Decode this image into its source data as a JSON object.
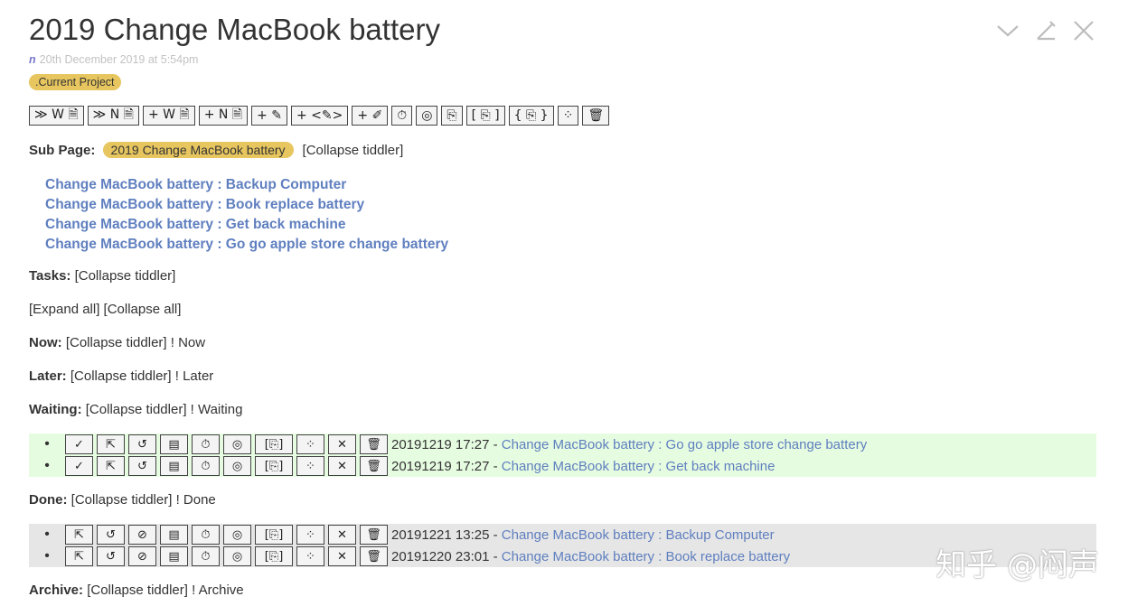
{
  "tiddler": {
    "title": "2019 Change MacBook battery",
    "modifier": "n",
    "modified": "20th December 2019 at 5:54pm",
    "tag": ".Current Project"
  },
  "toolbar": [
    {
      "label": "≫ W 🗎",
      "icon": "new-journal-w-icon"
    },
    {
      "label": "≫ N 🗎",
      "icon": "new-journal-n-icon"
    },
    {
      "label": "+ W 🗎",
      "icon": "new-w-icon"
    },
    {
      "label": "+ N 🗎",
      "icon": "new-n-icon"
    },
    {
      "label": "+ ✎",
      "icon": "new-pen-icon"
    },
    {
      "label": "+ <✎>",
      "icon": "new-code-pen-icon"
    },
    {
      "label": "+ ✐",
      "icon": "new-marker-icon"
    },
    {
      "label": "⏱",
      "icon": "timer-icon"
    },
    {
      "label": "◎",
      "icon": "target-icon"
    },
    {
      "label": "⎘",
      "icon": "export-icon"
    },
    {
      "label": "[ ⎘ ]",
      "icon": "bracket-export-icon"
    },
    {
      "label": "{ ⎘ }",
      "icon": "brace-export-icon"
    },
    {
      "label": "⁘",
      "icon": "graph-icon"
    },
    {
      "label": "🗑",
      "icon": "trash-icon"
    }
  ],
  "subpage": {
    "label": "Sub Page:",
    "pill": "2019 Change MacBook battery",
    "collapse": "[Collapse tiddler]",
    "links": [
      "Change MacBook battery : Backup Computer",
      "Change MacBook battery : Book replace battery",
      "Change MacBook battery : Get back machine",
      "Change MacBook battery : Go go apple store change battery"
    ]
  },
  "tasks": {
    "label": "Tasks:",
    "collapse": "[Collapse tiddler]"
  },
  "expand": {
    "text": "[Expand all] [Collapse all]"
  },
  "now": {
    "label": "Now:",
    "text": "[Collapse tiddler] ! Now"
  },
  "later": {
    "label": "Later:",
    "text": "[Collapse tiddler] ! Later"
  },
  "waiting": {
    "label": "Waiting:",
    "text": "[Collapse tiddler] ! Waiting",
    "rows": [
      {
        "date": "20191219 17:27 - ",
        "link": "Change MacBook battery : Go go apple store change battery"
      },
      {
        "date": "20191219 17:27 - ",
        "link": "Change MacBook battery : Get back machine"
      }
    ]
  },
  "done": {
    "label": "Done:",
    "text": "[Collapse tiddler] ! Done",
    "rows": [
      {
        "date": "20191221 13:25 - ",
        "link": "Change MacBook battery : Backup Computer"
      },
      {
        "date": "20191220 23:01 - ",
        "link": "Change MacBook battery : Book replace battery"
      }
    ]
  },
  "archive": {
    "label": "Archive:",
    "text": "[Collapse tiddler] ! Archive"
  },
  "watermark": "知乎 @闷声",
  "colors": {
    "link": "#5f7fbf",
    "tag": "#e7c65f",
    "waiting_band": "#e6fce1",
    "done_band": "#e6e6e6"
  }
}
